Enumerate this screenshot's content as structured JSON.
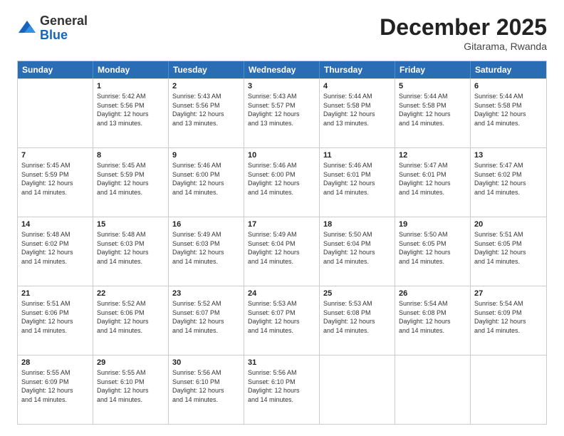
{
  "header": {
    "logo_general": "General",
    "logo_blue": "Blue",
    "month_title": "December 2025",
    "location": "Gitarama, Rwanda"
  },
  "weekdays": [
    "Sunday",
    "Monday",
    "Tuesday",
    "Wednesday",
    "Thursday",
    "Friday",
    "Saturday"
  ],
  "rows": [
    [
      {
        "day": "",
        "info": ""
      },
      {
        "day": "1",
        "info": "Sunrise: 5:42 AM\nSunset: 5:56 PM\nDaylight: 12 hours\nand 13 minutes."
      },
      {
        "day": "2",
        "info": "Sunrise: 5:43 AM\nSunset: 5:56 PM\nDaylight: 12 hours\nand 13 minutes."
      },
      {
        "day": "3",
        "info": "Sunrise: 5:43 AM\nSunset: 5:57 PM\nDaylight: 12 hours\nand 13 minutes."
      },
      {
        "day": "4",
        "info": "Sunrise: 5:44 AM\nSunset: 5:58 PM\nDaylight: 12 hours\nand 13 minutes."
      },
      {
        "day": "5",
        "info": "Sunrise: 5:44 AM\nSunset: 5:58 PM\nDaylight: 12 hours\nand 14 minutes."
      },
      {
        "day": "6",
        "info": "Sunrise: 5:44 AM\nSunset: 5:58 PM\nDaylight: 12 hours\nand 14 minutes."
      }
    ],
    [
      {
        "day": "7",
        "info": "Sunrise: 5:45 AM\nSunset: 5:59 PM\nDaylight: 12 hours\nand 14 minutes."
      },
      {
        "day": "8",
        "info": "Sunrise: 5:45 AM\nSunset: 5:59 PM\nDaylight: 12 hours\nand 14 minutes."
      },
      {
        "day": "9",
        "info": "Sunrise: 5:46 AM\nSunset: 6:00 PM\nDaylight: 12 hours\nand 14 minutes."
      },
      {
        "day": "10",
        "info": "Sunrise: 5:46 AM\nSunset: 6:00 PM\nDaylight: 12 hours\nand 14 minutes."
      },
      {
        "day": "11",
        "info": "Sunrise: 5:46 AM\nSunset: 6:01 PM\nDaylight: 12 hours\nand 14 minutes."
      },
      {
        "day": "12",
        "info": "Sunrise: 5:47 AM\nSunset: 6:01 PM\nDaylight: 12 hours\nand 14 minutes."
      },
      {
        "day": "13",
        "info": "Sunrise: 5:47 AM\nSunset: 6:02 PM\nDaylight: 12 hours\nand 14 minutes."
      }
    ],
    [
      {
        "day": "14",
        "info": "Sunrise: 5:48 AM\nSunset: 6:02 PM\nDaylight: 12 hours\nand 14 minutes."
      },
      {
        "day": "15",
        "info": "Sunrise: 5:48 AM\nSunset: 6:03 PM\nDaylight: 12 hours\nand 14 minutes."
      },
      {
        "day": "16",
        "info": "Sunrise: 5:49 AM\nSunset: 6:03 PM\nDaylight: 12 hours\nand 14 minutes."
      },
      {
        "day": "17",
        "info": "Sunrise: 5:49 AM\nSunset: 6:04 PM\nDaylight: 12 hours\nand 14 minutes."
      },
      {
        "day": "18",
        "info": "Sunrise: 5:50 AM\nSunset: 6:04 PM\nDaylight: 12 hours\nand 14 minutes."
      },
      {
        "day": "19",
        "info": "Sunrise: 5:50 AM\nSunset: 6:05 PM\nDaylight: 12 hours\nand 14 minutes."
      },
      {
        "day": "20",
        "info": "Sunrise: 5:51 AM\nSunset: 6:05 PM\nDaylight: 12 hours\nand 14 minutes."
      }
    ],
    [
      {
        "day": "21",
        "info": "Sunrise: 5:51 AM\nSunset: 6:06 PM\nDaylight: 12 hours\nand 14 minutes."
      },
      {
        "day": "22",
        "info": "Sunrise: 5:52 AM\nSunset: 6:06 PM\nDaylight: 12 hours\nand 14 minutes."
      },
      {
        "day": "23",
        "info": "Sunrise: 5:52 AM\nSunset: 6:07 PM\nDaylight: 12 hours\nand 14 minutes."
      },
      {
        "day": "24",
        "info": "Sunrise: 5:53 AM\nSunset: 6:07 PM\nDaylight: 12 hours\nand 14 minutes."
      },
      {
        "day": "25",
        "info": "Sunrise: 5:53 AM\nSunset: 6:08 PM\nDaylight: 12 hours\nand 14 minutes."
      },
      {
        "day": "26",
        "info": "Sunrise: 5:54 AM\nSunset: 6:08 PM\nDaylight: 12 hours\nand 14 minutes."
      },
      {
        "day": "27",
        "info": "Sunrise: 5:54 AM\nSunset: 6:09 PM\nDaylight: 12 hours\nand 14 minutes."
      }
    ],
    [
      {
        "day": "28",
        "info": "Sunrise: 5:55 AM\nSunset: 6:09 PM\nDaylight: 12 hours\nand 14 minutes."
      },
      {
        "day": "29",
        "info": "Sunrise: 5:55 AM\nSunset: 6:10 PM\nDaylight: 12 hours\nand 14 minutes."
      },
      {
        "day": "30",
        "info": "Sunrise: 5:56 AM\nSunset: 6:10 PM\nDaylight: 12 hours\nand 14 minutes."
      },
      {
        "day": "31",
        "info": "Sunrise: 5:56 AM\nSunset: 6:10 PM\nDaylight: 12 hours\nand 14 minutes."
      },
      {
        "day": "",
        "info": ""
      },
      {
        "day": "",
        "info": ""
      },
      {
        "day": "",
        "info": ""
      }
    ]
  ]
}
